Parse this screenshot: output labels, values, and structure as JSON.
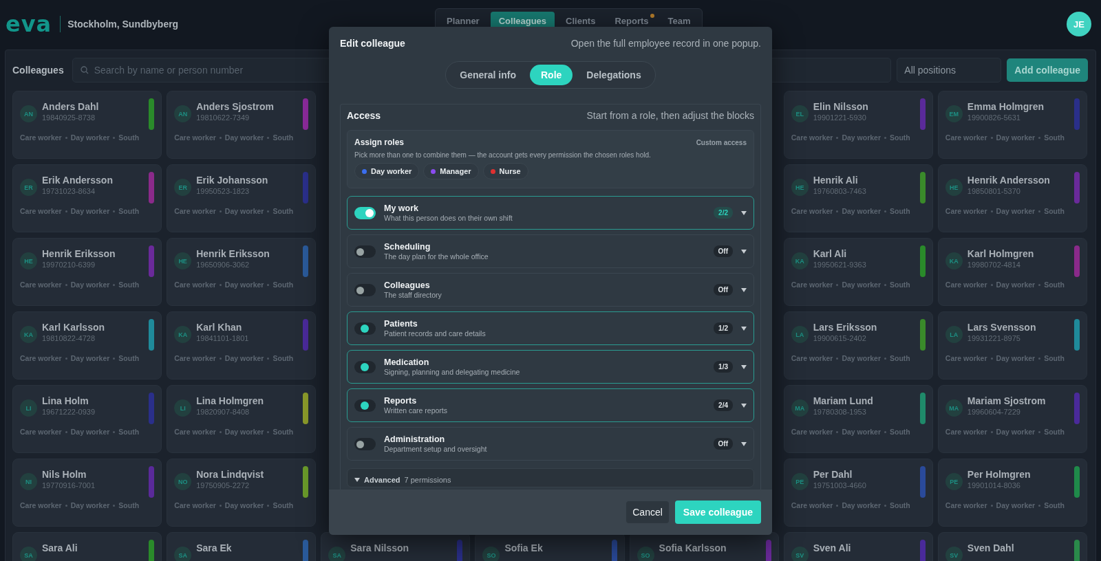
{
  "header": {
    "logo": "eva",
    "location": "Stockholm, Sundbyberg",
    "user_initials": "JE",
    "nav_tabs": [
      {
        "label": "Planner",
        "selected": false,
        "has_dot": false
      },
      {
        "label": "Colleagues",
        "selected": true,
        "has_dot": false
      },
      {
        "label": "Clients",
        "selected": false,
        "has_dot": false
      },
      {
        "label": "Reports",
        "selected": false,
        "has_dot": true
      },
      {
        "label": "Team",
        "selected": false,
        "has_dot": false
      }
    ]
  },
  "toolbar": {
    "title": "Colleagues",
    "search": {
      "placeholder": "Search by name or person number"
    },
    "position_filter": "All positions",
    "add_button": "Add colleague"
  },
  "card_rows": [
    {
      "cards": [
        {
          "initials": "AN",
          "name": "Anders Dahl",
          "number": "19840925-8738",
          "color": "#2a8a2a",
          "tags": [
            "Care worker",
            "Day worker",
            "South"
          ]
        },
        {
          "initials": "AN",
          "name": "Anders Sjostrom",
          "number": "19810622-7349",
          "color": "#8a2a9a",
          "tags": [
            "Care worker",
            "Day worker",
            "South"
          ]
        },
        {
          "initials": "EL",
          "name": "Elin Nilsson",
          "number": "19901221-5930",
          "color": "#5a2a9a",
          "tags": [
            "Care worker",
            "Day worker",
            "South"
          ]
        },
        {
          "initials": "EM",
          "name": "Emma Holmgren",
          "number": "19900826-5631",
          "color": "#2a2f8a",
          "tags": [
            "Care worker",
            "Day worker",
            "South"
          ]
        }
      ]
    },
    {
      "cards": [
        {
          "initials": "ER",
          "name": "Erik Andersson",
          "number": "19731023-8634",
          "color": "#8a2a8a",
          "tags": [
            "Care worker",
            "Day worker",
            "South"
          ]
        },
        {
          "initials": "ER",
          "name": "Erik Johansson",
          "number": "19950523-1823",
          "color": "#2a2f8a",
          "tags": [
            "Care worker",
            "Day worker",
            "South"
          ]
        },
        {
          "initials": "HE",
          "name": "Henrik Ali",
          "number": "19760803-7463",
          "color": "#3a8a2a",
          "tags": [
            "Care worker",
            "Day worker",
            "South"
          ]
        },
        {
          "initials": "HE",
          "name": "Henrik Andersson",
          "number": "19850801-5370",
          "color": "#6a2a9a",
          "tags": [
            "Care worker",
            "Day worker",
            "South"
          ]
        }
      ]
    },
    {
      "cards": [
        {
          "initials": "HE",
          "name": "Henrik Eriksson",
          "number": "19970210-6399",
          "color": "#6a2a9a",
          "tags": [
            "Care worker",
            "Day worker",
            "South"
          ]
        },
        {
          "initials": "HE",
          "name": "Henrik Eriksson",
          "number": "19650906-3062",
          "color": "#2a5a9a",
          "tags": [
            "Care worker",
            "Day worker",
            "South"
          ]
        },
        {
          "initials": "KA",
          "name": "Karl Ali",
          "number": "19950621-9363",
          "color": "#2a8a2a",
          "tags": [
            "Care worker",
            "Day worker",
            "South"
          ]
        },
        {
          "initials": "KA",
          "name": "Karl Holmgren",
          "number": "19980702-4814",
          "color": "#8a2a8a",
          "tags": [
            "Care worker",
            "Day worker",
            "South"
          ]
        }
      ]
    },
    {
      "cards": [
        {
          "initials": "KA",
          "name": "Karl Karlsson",
          "number": "19810822-4728",
          "color": "#1f8a9a",
          "tags": [
            "Care worker",
            "Day worker",
            "South"
          ]
        },
        {
          "initials": "KA",
          "name": "Karl Khan",
          "number": "19841101-1801",
          "color": "#4a2a9a",
          "tags": [
            "Care worker",
            "Day worker",
            "South"
          ]
        },
        {
          "initials": "LA",
          "name": "Lars Eriksson",
          "number": "19900615-2402",
          "color": "#3a8a2a",
          "tags": [
            "Care worker",
            "Day worker",
            "South"
          ]
        },
        {
          "initials": "LA",
          "name": "Lars Svensson",
          "number": "19931221-8975",
          "color": "#1f8a9a",
          "tags": [
            "Care worker",
            "Day worker",
            "South"
          ]
        }
      ]
    },
    {
      "cards": [
        {
          "initials": "LI",
          "name": "Lina Holm",
          "number": "19671222-0939",
          "color": "#2a2f8a",
          "tags": [
            "Care worker",
            "Day worker",
            "South"
          ]
        },
        {
          "initials": "LI",
          "name": "Lina Holmgren",
          "number": "19820907-8408",
          "color": "#8a9a2a",
          "tags": [
            "Care worker",
            "Day worker",
            "South"
          ]
        },
        {
          "initials": "MA",
          "name": "Mariam Lund",
          "number": "19780308-1953",
          "color": "#1f8a6a",
          "tags": [
            "Care worker",
            "Day worker",
            "South"
          ]
        },
        {
          "initials": "MA",
          "name": "Mariam Sjostrom",
          "number": "19960604-7229",
          "color": "#4a2a9a",
          "tags": [
            "Care worker",
            "Day worker",
            "South"
          ]
        }
      ]
    },
    {
      "cards": [
        {
          "initials": "NI",
          "name": "Nils Holm",
          "number": "19770916-7001",
          "color": "#5a2a9a",
          "tags": [
            "Care worker",
            "Day worker",
            "South"
          ]
        },
        {
          "initials": "NO",
          "name": "Nora Lindqvist",
          "number": "19750905-2272",
          "color": "#6a9a2a",
          "tags": [
            "Care worker",
            "Day worker",
            "South"
          ]
        },
        {
          "initials": "PE",
          "name": "Per Dahl",
          "number": "19751003-4660",
          "color": "#2a4a9a",
          "tags": [
            "Care worker",
            "Day worker",
            "South"
          ]
        },
        {
          "initials": "PE",
          "name": "Per Holmgren",
          "number": "19901014-8036",
          "color": "#1f8a4a",
          "tags": [
            "Care worker",
            "Day worker",
            "South"
          ]
        }
      ]
    },
    {
      "cards": [
        {
          "initials": "SA",
          "name": "Sara Ali",
          "color": "#2a8a2a"
        },
        {
          "initials": "SA",
          "name": "Sara Ek",
          "color": "#2a5a9a"
        },
        {
          "initials": "SA",
          "name": "Sara Nilsson",
          "color": "#2a2f8a"
        },
        {
          "initials": "SO",
          "name": "Sofia Ek",
          "color": "#2a4a9a"
        },
        {
          "initials": "SO",
          "name": "Sofia Karlsson",
          "color": "#6a2a9a"
        },
        {
          "initials": "SV",
          "name": "Sven Ali",
          "color": "#4a2a9a"
        },
        {
          "initials": "SV",
          "name": "Sven Dahl",
          "color": "#2a8a4a"
        }
      ]
    }
  ],
  "modal": {
    "title": "Edit colleague",
    "subtitle": "Open the full employee record in one popup.",
    "tabs": [
      {
        "label": "General info",
        "selected": false
      },
      {
        "label": "Role",
        "selected": true
      },
      {
        "label": "Delegations",
        "selected": false
      }
    ],
    "access": {
      "title": "Access",
      "hint": "Start from a role, then adjust the blocks",
      "assign_roles": {
        "title": "Assign roles",
        "status": "Custom access",
        "description": "Pick more than one to combine them — the account gets every permission the chosen roles hold.",
        "roles": [
          {
            "label": "Day worker",
            "color": "#3b6ef0"
          },
          {
            "label": "Manager",
            "color": "#8b4cf0"
          },
          {
            "label": "Nurse",
            "color": "#e03030"
          }
        ]
      },
      "blocks": [
        {
          "title": "My work",
          "description": "What this person does on their own shift",
          "on": true,
          "partial": false,
          "count": "2/2"
        },
        {
          "title": "Scheduling",
          "description": "The day plan for the whole office",
          "on": false,
          "partial": false,
          "count": "Off"
        },
        {
          "title": "Colleagues",
          "description": "The staff directory",
          "on": false,
          "partial": false,
          "count": "Off"
        },
        {
          "title": "Patients",
          "description": "Patient records and care details",
          "on": false,
          "partial": true,
          "count": "1/2"
        },
        {
          "title": "Medication",
          "description": "Signing, planning and delegating medicine",
          "on": false,
          "partial": true,
          "count": "1/3"
        },
        {
          "title": "Reports",
          "description": "Written care reports",
          "on": false,
          "partial": true,
          "count": "2/4"
        },
        {
          "title": "Administration",
          "description": "Department setup and oversight",
          "on": false,
          "partial": false,
          "count": "Off"
        }
      ],
      "advanced": {
        "label": "Advanced",
        "count": "7 permissions"
      }
    },
    "buttons": {
      "cancel": "Cancel",
      "save": "Save colleague"
    }
  }
}
